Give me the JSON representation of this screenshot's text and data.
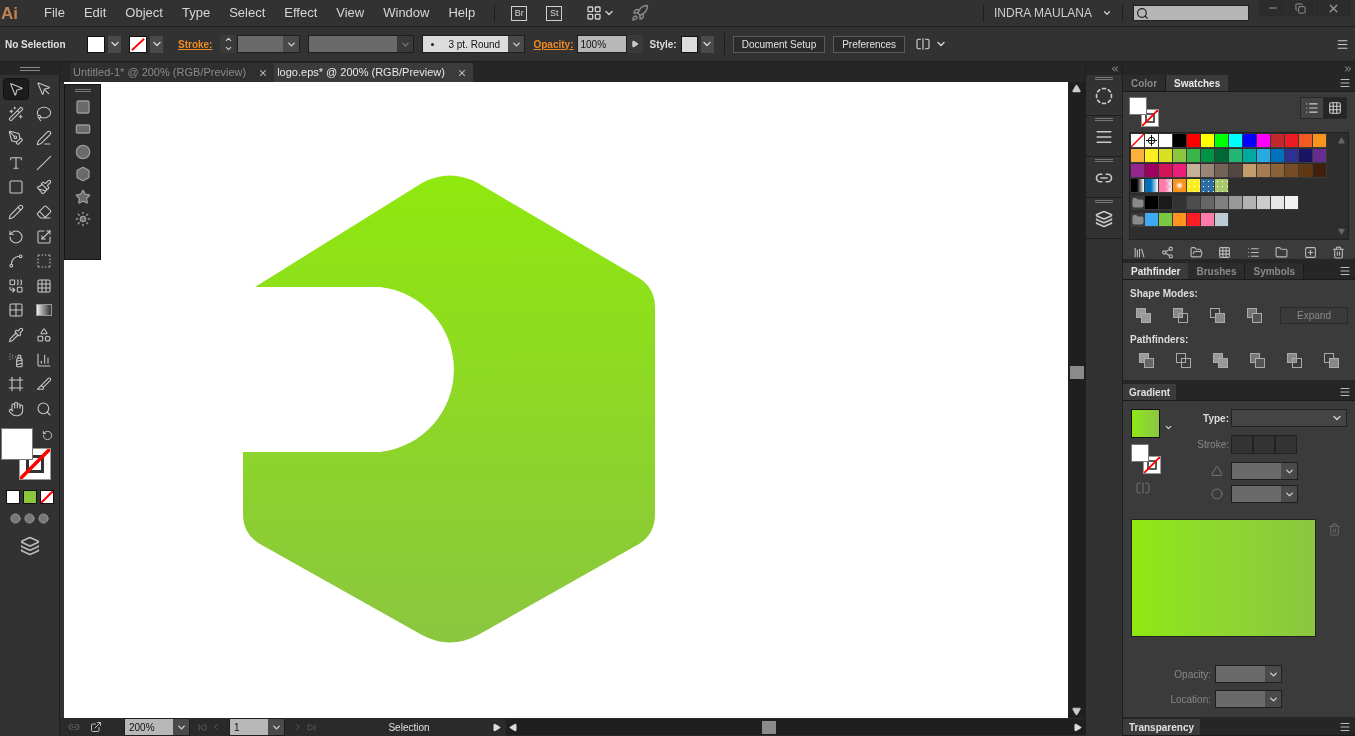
{
  "app_logo": "Ai",
  "menu": [
    "File",
    "Edit",
    "Object",
    "Type",
    "Select",
    "Effect",
    "View",
    "Window",
    "Help"
  ],
  "bridge_buttons": [
    "Br",
    "St"
  ],
  "user": "INDRA MAULANA",
  "control_bar": {
    "selection": "No Selection",
    "stroke_label": "Stroke:",
    "brush": "3 pt. Round",
    "opacity_label": "Opacity:",
    "opacity": "100%",
    "style_label": "Style:",
    "buttons": [
      "Document Setup",
      "Preferences"
    ]
  },
  "tools": [
    {
      "kind": "selection",
      "selected": true
    },
    {
      "kind": "direct-selection",
      "selected": false
    },
    {
      "kind": "magic-wand",
      "selected": false
    },
    {
      "kind": "lasso",
      "selected": false
    },
    {
      "kind": "pen",
      "selected": false
    },
    {
      "kind": "curvature",
      "selected": false
    },
    {
      "kind": "type",
      "selected": false
    },
    {
      "kind": "line",
      "selected": false
    },
    {
      "kind": "rectangle",
      "selected": false
    },
    {
      "kind": "paintbrush",
      "selected": false
    },
    {
      "kind": "pencil",
      "selected": false
    },
    {
      "kind": "eraser",
      "selected": false
    },
    {
      "kind": "rotate",
      "selected": false
    },
    {
      "kind": "scale",
      "selected": false
    },
    {
      "kind": "puppet-warp",
      "selected": false
    },
    {
      "kind": "free-transform",
      "selected": false
    },
    {
      "kind": "shape-builder",
      "selected": false
    },
    {
      "kind": "perspective-grid",
      "selected": false
    },
    {
      "kind": "mesh",
      "selected": false
    },
    {
      "kind": "gradient",
      "selected": false
    },
    {
      "kind": "eyedropper",
      "selected": false
    },
    {
      "kind": "blend",
      "selected": false
    },
    {
      "kind": "symbol-sprayer",
      "selected": false
    },
    {
      "kind": "column-graph",
      "selected": false
    },
    {
      "kind": "artboard",
      "selected": false
    },
    {
      "kind": "slice",
      "selected": false
    },
    {
      "kind": "hand",
      "selected": false
    },
    {
      "kind": "zoom",
      "selected": false
    }
  ],
  "shape_tools": [
    {
      "kind": "rectangle"
    },
    {
      "kind": "rounded-rectangle"
    },
    {
      "kind": "ellipse"
    },
    {
      "kind": "polygon"
    },
    {
      "kind": "star"
    },
    {
      "kind": "flare"
    }
  ],
  "document_tabs": [
    {
      "title": "Untitled-1* @ 200% (RGB/Preview)",
      "selected": false
    },
    {
      "title": "logo.eps* @ 200% (RGB/Preview)",
      "selected": true
    }
  ],
  "status_bar": {
    "zoom": "200%",
    "artboard": "1",
    "tool": "Selection"
  },
  "swatches_panel": {
    "tabs": [
      {
        "label": "Color",
        "selected": false
      },
      {
        "label": "Swatches",
        "selected": true
      }
    ],
    "view_buttons": [
      {
        "kind": "list",
        "selected": false
      },
      {
        "kind": "grid",
        "selected": true
      }
    ],
    "rows": [
      [
        {
          "kind": "none"
        },
        {
          "kind": "registration"
        },
        {
          "kind": "color",
          "color": "#ffffff"
        },
        {
          "kind": "color",
          "color": "#000000"
        },
        {
          "kind": "color",
          "color": "#ff0000"
        },
        {
          "kind": "color",
          "color": "#ffff00"
        },
        {
          "kind": "color",
          "color": "#00ff00"
        },
        {
          "kind": "color",
          "color": "#00ffff"
        },
        {
          "kind": "color",
          "color": "#0000ff"
        },
        {
          "kind": "color",
          "color": "#ff00ff"
        },
        {
          "kind": "color",
          "color": "#c1272d"
        },
        {
          "kind": "color",
          "color": "#ed1c24"
        },
        {
          "kind": "color",
          "color": "#f15a24"
        },
        {
          "kind": "color",
          "color": "#f7931e"
        }
      ],
      [
        {
          "kind": "color",
          "color": "#fbb03b"
        },
        {
          "kind": "color",
          "color": "#fcee21"
        },
        {
          "kind": "color",
          "color": "#d9e021"
        },
        {
          "kind": "color",
          "color": "#8cc63f"
        },
        {
          "kind": "color",
          "color": "#39b54a"
        },
        {
          "kind": "color",
          "color": "#009245"
        },
        {
          "kind": "color",
          "color": "#006837"
        },
        {
          "kind": "color",
          "color": "#22b573"
        },
        {
          "kind": "color",
          "color": "#00a99d"
        },
        {
          "kind": "color",
          "color": "#29abe2"
        },
        {
          "kind": "color",
          "color": "#0071bc"
        },
        {
          "kind": "color",
          "color": "#2e3192"
        },
        {
          "kind": "color",
          "color": "#1b1464"
        },
        {
          "kind": "color",
          "color": "#662d91"
        }
      ],
      [
        {
          "kind": "color",
          "color": "#93278f"
        },
        {
          "kind": "color",
          "color": "#9e005d"
        },
        {
          "kind": "color",
          "color": "#d4145a"
        },
        {
          "kind": "color",
          "color": "#ed1e79"
        },
        {
          "kind": "color",
          "color": "#c7b299"
        },
        {
          "kind": "color",
          "color": "#998675"
        },
        {
          "kind": "color",
          "color": "#736357"
        },
        {
          "kind": "color",
          "color": "#534741"
        },
        {
          "kind": "color",
          "color": "#c69c6d"
        },
        {
          "kind": "color",
          "color": "#a67c52"
        },
        {
          "kind": "color",
          "color": "#8c6239"
        },
        {
          "kind": "color",
          "color": "#754c24"
        },
        {
          "kind": "color",
          "color": "#603813"
        },
        {
          "kind": "color",
          "color": "#42210b"
        }
      ],
      [
        {
          "kind": "gradient",
          "color": "#000000"
        },
        {
          "kind": "gradient",
          "color": "#0071bc"
        },
        {
          "kind": "checker",
          "color": "#ff7bac"
        },
        {
          "kind": "radial",
          "color": "#f7931e"
        },
        {
          "kind": "pattern",
          "color": "#fcee21"
        },
        {
          "kind": "pattern",
          "color": "#2e6da4"
        },
        {
          "kind": "pattern",
          "color": "#a9c96b"
        }
      ],
      [
        {
          "kind": "folder"
        },
        {
          "kind": "color",
          "color": "#000000"
        },
        {
          "kind": "color",
          "color": "#1a1a1a"
        },
        {
          "kind": "color",
          "color": "#333333"
        },
        {
          "kind": "color",
          "color": "#4d4d4d"
        },
        {
          "kind": "color",
          "color": "#666666"
        },
        {
          "kind": "color",
          "color": "#808080"
        },
        {
          "kind": "color",
          "color": "#999999"
        },
        {
          "kind": "color",
          "color": "#b3b3b3"
        },
        {
          "kind": "color",
          "color": "#cccccc"
        },
        {
          "kind": "color",
          "color": "#e6e6e6"
        },
        {
          "kind": "color",
          "color": "#f2f2f2"
        }
      ],
      [
        {
          "kind": "folder"
        },
        {
          "kind": "color",
          "color": "#3fa9f5"
        },
        {
          "kind": "color",
          "color": "#7ac943"
        },
        {
          "kind": "color",
          "color": "#ff931e"
        },
        {
          "kind": "color",
          "color": "#ff1d25"
        },
        {
          "kind": "color",
          "color": "#ff7bac"
        },
        {
          "kind": "color",
          "color": "#bdccd4"
        }
      ]
    ]
  },
  "pathfinder_panel": {
    "tabs": [
      {
        "label": "Pathfinder",
        "selected": true
      },
      {
        "label": "Brushes",
        "selected": false
      },
      {
        "label": "Symbols",
        "selected": false
      }
    ],
    "shape_modes_label": "Shape Modes:",
    "expand": {
      "label": "Expand",
      "disabled": true
    },
    "pathfinders_label": "Pathfinders:"
  },
  "gradient_panel": {
    "title": "Gradient",
    "type_label": "Type:",
    "stroke_label": "Stroke:",
    "opacity_label": "Opacity:",
    "location_label": "Location:"
  },
  "transparency_panel": {
    "title": "Transparency"
  }
}
